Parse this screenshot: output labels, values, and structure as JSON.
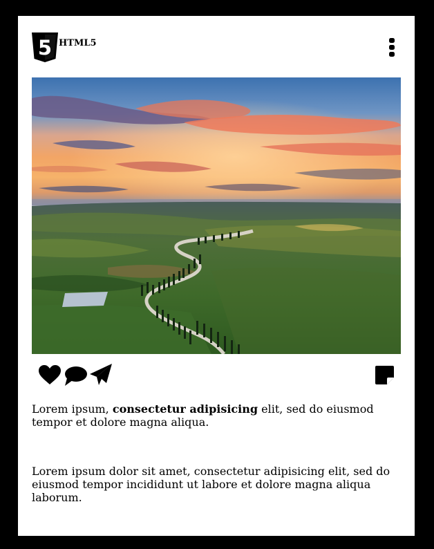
{
  "post": {
    "brand_label": "HTML5",
    "logo_number": "5",
    "caption": {
      "lead": "Lorem ipsum, ",
      "bold": "consectetur adipisicing",
      "tail": " elit, sed do eiusmod tempor et dolore magna aliqua."
    },
    "body": "Lorem ipsum dolor sit amet, consectetur adipisicing elit, sed do eiusmod tempor incididunt ut labore et dolore magna aliqua laborum.",
    "icons": {
      "logo": "html5-logo-icon",
      "menu": "more-vertical-icon",
      "like": "heart-icon",
      "comment": "speech-bubble-icon",
      "share": "paper-plane-icon",
      "save": "sticky-note-icon"
    }
  },
  "colors": {
    "page_background": "#000000",
    "card_background": "#ffffff",
    "icon": "#000000"
  }
}
